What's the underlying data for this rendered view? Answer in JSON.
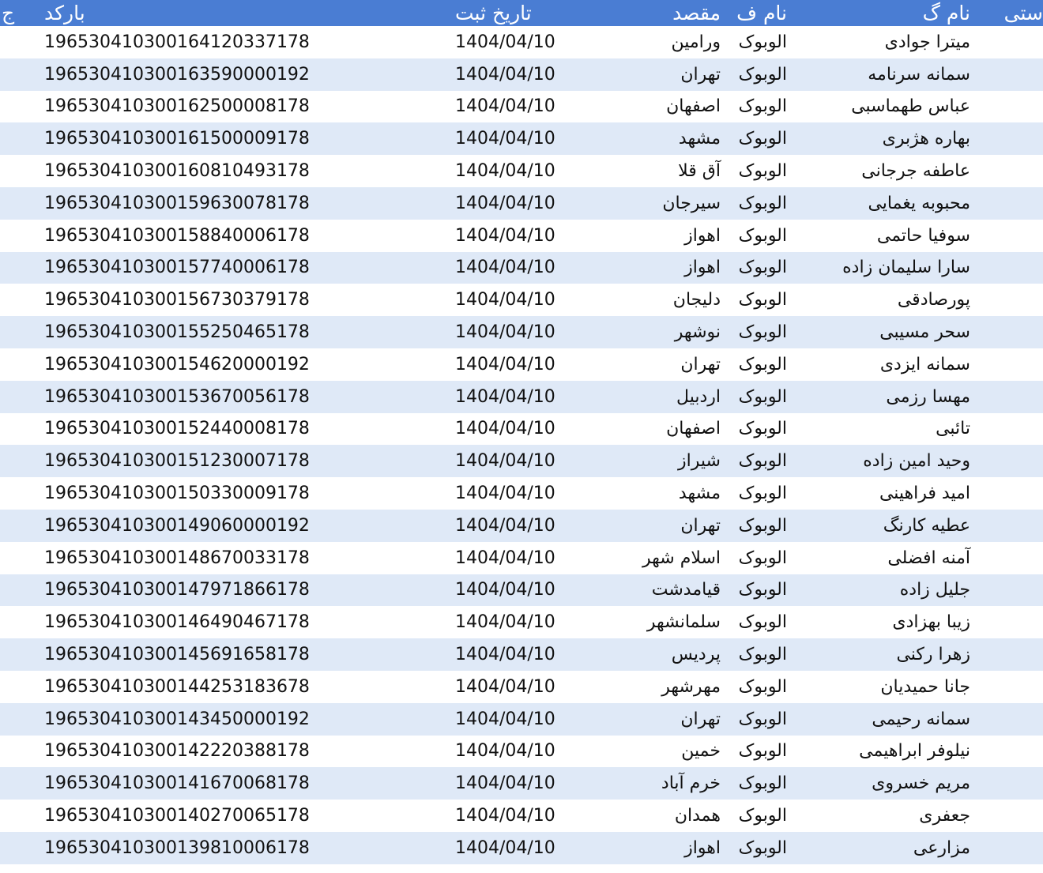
{
  "colors": {
    "header_bg": "#4a7dd3",
    "band_bg": "#dfe9f7",
    "row_bg": "#ffffff"
  },
  "headers": {
    "edge": "ج",
    "barcode": "بارکد",
    "date": "تاریخ ثبت",
    "destination": "مقصد",
    "first_name": "نام ف",
    "last_name": "نام گ",
    "postal": "ستی"
  },
  "rows": [
    {
      "barcode": "196530410300164120337178",
      "date": "1404/04/10",
      "destination": "ورامین",
      "first_name": "الوبوک",
      "last_name": "میترا جوادی"
    },
    {
      "barcode": "196530410300163590000192",
      "date": "1404/04/10",
      "destination": "تهران",
      "first_name": "الوبوک",
      "last_name": "سمانه سرنامه"
    },
    {
      "barcode": "196530410300162500008178",
      "date": "1404/04/10",
      "destination": "اصفهان",
      "first_name": "الوبوک",
      "last_name": "عباس طهماسبی"
    },
    {
      "barcode": "196530410300161500009178",
      "date": "1404/04/10",
      "destination": "مشهد",
      "first_name": "الوبوک",
      "last_name": "بهاره هژبری"
    },
    {
      "barcode": "196530410300160810493178",
      "date": "1404/04/10",
      "destination": "آق قلا",
      "first_name": "الوبوک",
      "last_name": "عاطفه جرجانی"
    },
    {
      "barcode": "196530410300159630078178",
      "date": "1404/04/10",
      "destination": "سیرجان",
      "first_name": "الوبوک",
      "last_name": "محبوبه یغمایی"
    },
    {
      "barcode": "196530410300158840006178",
      "date": "1404/04/10",
      "destination": "اهواز",
      "first_name": "الوبوک",
      "last_name": "سوفیا حاتمی"
    },
    {
      "barcode": "196530410300157740006178",
      "date": "1404/04/10",
      "destination": "اهواز",
      "first_name": "الوبوک",
      "last_name": "سارا سلیمان زاده"
    },
    {
      "barcode": "196530410300156730379178",
      "date": "1404/04/10",
      "destination": "دلیجان",
      "first_name": "الوبوک",
      "last_name": "پورصادقی"
    },
    {
      "barcode": "196530410300155250465178",
      "date": "1404/04/10",
      "destination": "نوشهر",
      "first_name": "الوبوک",
      "last_name": "سحر مسیبی"
    },
    {
      "barcode": "196530410300154620000192",
      "date": "1404/04/10",
      "destination": "تهران",
      "first_name": "الوبوک",
      "last_name": "سمانه ایزدی"
    },
    {
      "barcode": "196530410300153670056178",
      "date": "1404/04/10",
      "destination": "اردبیل",
      "first_name": "الوبوک",
      "last_name": "مهسا رزمی"
    },
    {
      "barcode": "196530410300152440008178",
      "date": "1404/04/10",
      "destination": "اصفهان",
      "first_name": "الوبوک",
      "last_name": "تائبی"
    },
    {
      "barcode": "196530410300151230007178",
      "date": "1404/04/10",
      "destination": "شیراز",
      "first_name": "الوبوک",
      "last_name": "وحید امین زاده"
    },
    {
      "barcode": "196530410300150330009178",
      "date": "1404/04/10",
      "destination": "مشهد",
      "first_name": "الوبوک",
      "last_name": "امید فراهینی"
    },
    {
      "barcode": "196530410300149060000192",
      "date": "1404/04/10",
      "destination": "تهران",
      "first_name": "الوبوک",
      "last_name": "عطیه کارنگ"
    },
    {
      "barcode": "196530410300148670033178",
      "date": "1404/04/10",
      "destination": "اسلام شهر",
      "first_name": "الوبوک",
      "last_name": "آمنه افضلی"
    },
    {
      "barcode": "196530410300147971866178",
      "date": "1404/04/10",
      "destination": "قیامدشت",
      "first_name": "الوبوک",
      "last_name": "جلیل زاده"
    },
    {
      "barcode": "196530410300146490467178",
      "date": "1404/04/10",
      "destination": "سلمانشهر",
      "first_name": "الوبوک",
      "last_name": "زیبا بهزادی"
    },
    {
      "barcode": "196530410300145691658178",
      "date": "1404/04/10",
      "destination": "پردیس",
      "first_name": "الوبوک",
      "last_name": "زهرا رکنی"
    },
    {
      "barcode": "196530410300144253183678",
      "date": "1404/04/10",
      "destination": "مهرشهر",
      "first_name": "الوبوک",
      "last_name": "جانا حمیدیان"
    },
    {
      "barcode": "196530410300143450000192",
      "date": "1404/04/10",
      "destination": "تهران",
      "first_name": "الوبوک",
      "last_name": "سمانه رحیمی"
    },
    {
      "barcode": "196530410300142220388178",
      "date": "1404/04/10",
      "destination": "خمین",
      "first_name": "الوبوک",
      "last_name": "نیلوفر ابراهیمی"
    },
    {
      "barcode": "196530410300141670068178",
      "date": "1404/04/10",
      "destination": "خرم آباد",
      "first_name": "الوبوک",
      "last_name": "مریم خسروی"
    },
    {
      "barcode": "196530410300140270065178",
      "date": "1404/04/10",
      "destination": "همدان",
      "first_name": "الوبوک",
      "last_name": "جعفری"
    },
    {
      "barcode": "196530410300139810006178",
      "date": "1404/04/10",
      "destination": "اهواز",
      "first_name": "الوبوک",
      "last_name": "مزارعی"
    }
  ]
}
